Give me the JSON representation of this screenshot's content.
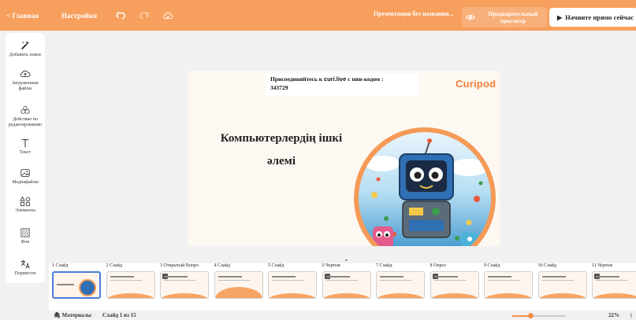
{
  "topbar": {
    "back_label": "< Главная",
    "settings_label": "Настройки",
    "presentation_name": "Презентация без названия...",
    "preview_label": "Предварительный просмотр",
    "start_label": "Начните прямо сейчас"
  },
  "sidebar": {
    "items": [
      {
        "label": "Добавить новое",
        "icon": "magic-wand-icon"
      },
      {
        "label": "Загруженные файлы",
        "icon": "cloud-upload-icon"
      },
      {
        "label": "Действие по редактированию",
        "icon": "actions-icon"
      },
      {
        "label": "Текст",
        "icon": "text-icon"
      },
      {
        "label": "Медиафайлы",
        "icon": "image-icon"
      },
      {
        "label": "Элементы",
        "icon": "shapes-icon"
      },
      {
        "label": "Фон",
        "icon": "background-icon"
      },
      {
        "label": "Перевести",
        "icon": "translate-icon"
      }
    ]
  },
  "slide": {
    "join_text": "Присоединяйтесь к",
    "join_brand": "curi.live",
    "join_suffix": "с пин-кодом :",
    "pin": "343729",
    "logo": "Curipod",
    "title": "Компьютерлердің ішкі әлемі"
  },
  "filmstrip": {
    "slides": [
      {
        "label": "1 Слайд",
        "active": true,
        "kind": "title"
      },
      {
        "label": "2 Слайд",
        "active": false,
        "kind": "text"
      },
      {
        "label": "3 Открытый Вопро",
        "active": false,
        "kind": "question"
      },
      {
        "label": "4 Слайд",
        "active": false,
        "kind": "arc"
      },
      {
        "label": "5 Слайд",
        "active": false,
        "kind": "text"
      },
      {
        "label": "6 Чертеж",
        "active": false,
        "kind": "question"
      },
      {
        "label": "7 Слайд",
        "active": false,
        "kind": "text"
      },
      {
        "label": "8 Опрос",
        "active": false,
        "kind": "question"
      },
      {
        "label": "9 Слайд",
        "active": false,
        "kind": "text"
      },
      {
        "label": "10 Слайд",
        "active": false,
        "kind": "text"
      },
      {
        "label": "11 Чертеж",
        "active": false,
        "kind": "question"
      }
    ]
  },
  "status": {
    "materials_label": "Материалы",
    "slide_counter": "Слайд 1 из 15",
    "zoom": "22%",
    "zoom_level": 0.35
  },
  "colors": {
    "accent": "#f79f5c",
    "active_thumb": "#4a7bd8"
  }
}
